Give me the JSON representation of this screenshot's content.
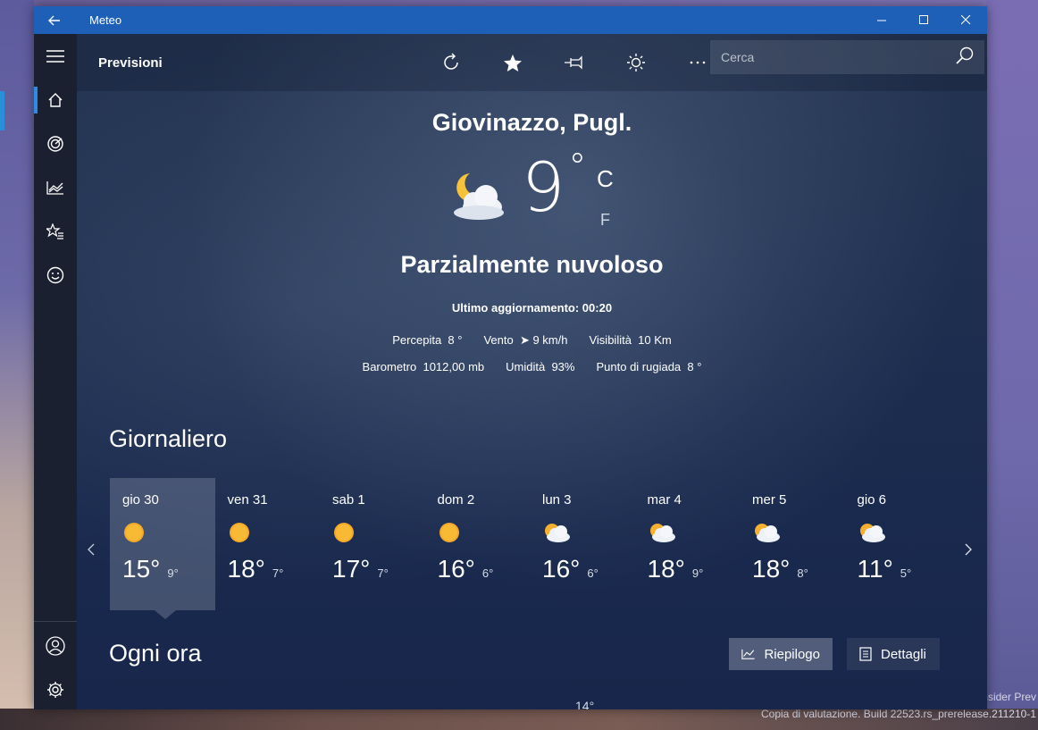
{
  "window": {
    "title": "Meteo",
    "back_icon": "back-arrow-icon",
    "controls": [
      "minimize-icon",
      "maximize-icon",
      "close-icon"
    ]
  },
  "sidebar": {
    "items": [
      {
        "name": "menu",
        "icon": "hamburger-icon"
      },
      {
        "name": "home",
        "icon": "home-icon",
        "active": true
      },
      {
        "name": "maps",
        "icon": "radar-icon"
      },
      {
        "name": "historical",
        "icon": "chart-icon"
      },
      {
        "name": "favorites",
        "icon": "star-list-icon"
      },
      {
        "name": "news",
        "icon": "smiley-icon"
      }
    ],
    "bottom_items": [
      {
        "name": "account",
        "icon": "user-icon"
      },
      {
        "name": "settings",
        "icon": "gear-icon"
      }
    ]
  },
  "header": {
    "title": "Previsioni",
    "tools": [
      "refresh-icon",
      "star-icon",
      "pin-icon",
      "brightness-icon",
      "more-icon"
    ],
    "search_placeholder": "Cerca"
  },
  "current": {
    "location": "Giovinazzo, Pugl.",
    "temperature": "9",
    "degree": "°",
    "unit_c": "C",
    "unit_f": "F",
    "condition": "Parzialmente nuvoloso",
    "updated": "Ultimo aggiornamento: 00:20",
    "feels_label": "Percepita",
    "feels_value": "8 °",
    "wind_label": "Vento",
    "wind_value": "➤ 9 km/h",
    "visibility_label": "Visibilità",
    "visibility_value": "10 Km",
    "pressure_label": "Barometro",
    "pressure_value": "1012,00 mb",
    "humidity_label": "Umidità",
    "humidity_value": "93%",
    "dew_label": "Punto di rugiada",
    "dew_value": "8 °"
  },
  "daily": {
    "title": "Giornaliero",
    "days": [
      {
        "label": "gio 30",
        "icon": "sun-icon",
        "hi": "15°",
        "lo": "9°",
        "selected": true
      },
      {
        "label": "ven 31",
        "icon": "sun-icon",
        "hi": "18°",
        "lo": "7°"
      },
      {
        "label": "sab 1",
        "icon": "sun-icon",
        "hi": "17°",
        "lo": "7°"
      },
      {
        "label": "dom 2",
        "icon": "sun-icon",
        "hi": "16°",
        "lo": "6°"
      },
      {
        "label": "lun 3",
        "icon": "partly-cloudy-icon",
        "hi": "16°",
        "lo": "6°"
      },
      {
        "label": "mar 4",
        "icon": "partly-cloudy-icon",
        "hi": "18°",
        "lo": "9°"
      },
      {
        "label": "mer 5",
        "icon": "partly-cloudy-icon",
        "hi": "18°",
        "lo": "8°"
      },
      {
        "label": "gio 6",
        "icon": "partly-cloudy-icon",
        "hi": "11°",
        "lo": "5°"
      }
    ]
  },
  "hourly": {
    "title": "Ogni ora",
    "summary_button": "Riepilogo",
    "details_button": "Dettagli",
    "first_value": "14°"
  },
  "watermark": {
    "line1": "nsider Prev",
    "line2": "Copia di valutazione. Build 22523.rs_prerelease.211210-1"
  }
}
